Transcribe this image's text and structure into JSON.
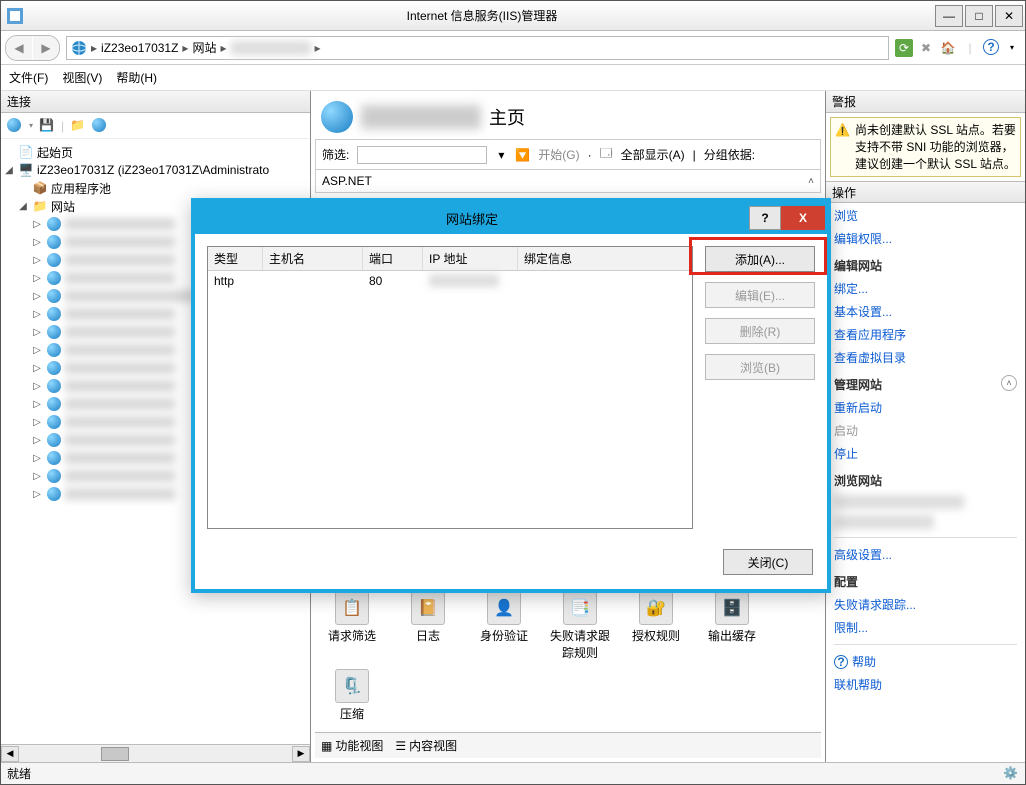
{
  "window": {
    "title": "Internet 信息服务(IIS)管理器",
    "min": "—",
    "max": "□",
    "close": "✕"
  },
  "breadcrumb": {
    "server": "iZ23eo17031Z",
    "sites": "网站",
    "sep": "▸",
    "play": "▸"
  },
  "nav_icons": {
    "refresh": "↻",
    "stop": "⨯",
    "home": "⌂",
    "help": "?"
  },
  "menus": {
    "file": "文件(F)",
    "view": "视图(V)",
    "help": "帮助(H)"
  },
  "left": {
    "header": "连接",
    "start_page": "起始页",
    "server": "iZ23eo17031Z (iZ23eo17031Z\\Administrato",
    "app_pools": "应用程序池",
    "sites": "网站"
  },
  "center": {
    "title_suffix": "主页",
    "filter_label": "筛选:",
    "start": "开始(G)",
    "show_all": "全部显示(A)",
    "group_by": "分组依据:",
    "aspnet": "ASP.NET",
    "features": {
      "request_filtering": "请求筛选",
      "logging": "日志",
      "authentication": "身份验证",
      "failed_request": "失败请求跟踪规则",
      "authorization": "授权规则",
      "output_cache": "输出缓存",
      "compression": "压缩"
    },
    "view_features": "功能视图",
    "view_content": "内容视图"
  },
  "right": {
    "header": "警报",
    "ssl_warning": "尚未创建默认 SSL 站点。若要支持不带 SNI 功能的浏览器，建议创建一个默认 SSL 站点。",
    "actions_header": "操作",
    "browse": "浏览",
    "edit_permissions": "编辑权限...",
    "edit_site": "编辑网站",
    "bindings": "绑定...",
    "basic_settings": "基本设置...",
    "app_view": "查看应用程序",
    "vdir_view": "查看虚拟目录",
    "manage_site": "管理网站",
    "restart": "重新启动",
    "start": "启动",
    "stop": "停止",
    "browse_site": "浏览网站",
    "advanced": "高级设置...",
    "configure": "配置",
    "failed_trace": "失败请求跟踪...",
    "limits": "限制...",
    "help": "帮助",
    "online_help": "联机帮助"
  },
  "dialog": {
    "title": "网站绑定",
    "help": "?",
    "close": "X",
    "columns": {
      "type": "类型",
      "host": "主机名",
      "port": "端口",
      "ip": "IP 地址",
      "bind": "绑定信息"
    },
    "row": {
      "type": "http",
      "host": "",
      "port": "80",
      "ip": "",
      "bind": ""
    },
    "buttons": {
      "add": "添加(A)...",
      "edit": "编辑(E)...",
      "remove": "删除(R)",
      "browse": "浏览(B)",
      "close": "关闭(C)"
    }
  },
  "status": {
    "ready": "就绪"
  }
}
